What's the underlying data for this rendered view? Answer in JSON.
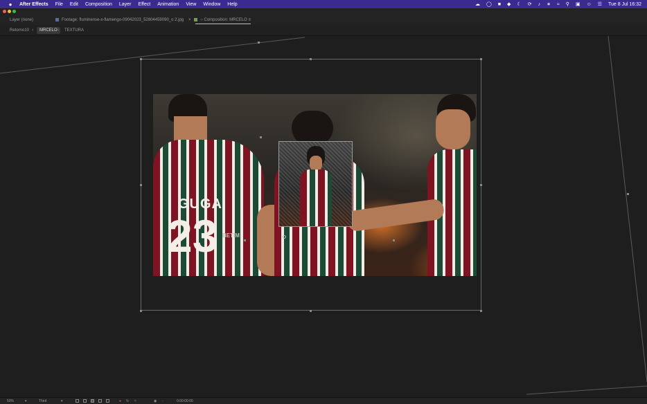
{
  "menubar": {
    "app_name": "After Effects",
    "menus": [
      "File",
      "Edit",
      "Composition",
      "Layer",
      "Effect",
      "Animation",
      "View",
      "Window",
      "Help"
    ],
    "clock": "Tue 8 Jul  16:32"
  },
  "panel_tabs": {
    "layer": "Layer (none)",
    "footage": "Footage: fluminense-x-flamengo-09042023_52804459090_o 2.jpg",
    "composition": "Composition: MRCELO"
  },
  "comp_tabs": [
    "Retorno10",
    "MRCELO",
    "TEXTURA"
  ],
  "photo": {
    "jersey_name": "GUGA",
    "jersey_number": "23",
    "jersey_sleeve_text": "BETIM"
  },
  "toolbar": {
    "zoom": "50%",
    "resolution": "Third",
    "timecode": "0:00:00:00"
  },
  "colors": {
    "menubar_bg": "#3b2a8f",
    "viewer_bg": "#1e1e1e",
    "footage_swatch": "#5a6e96",
    "comp_swatch": "#7a9a5a",
    "jersey_maroon": "#7e1421",
    "jersey_green": "#1d4a34"
  }
}
